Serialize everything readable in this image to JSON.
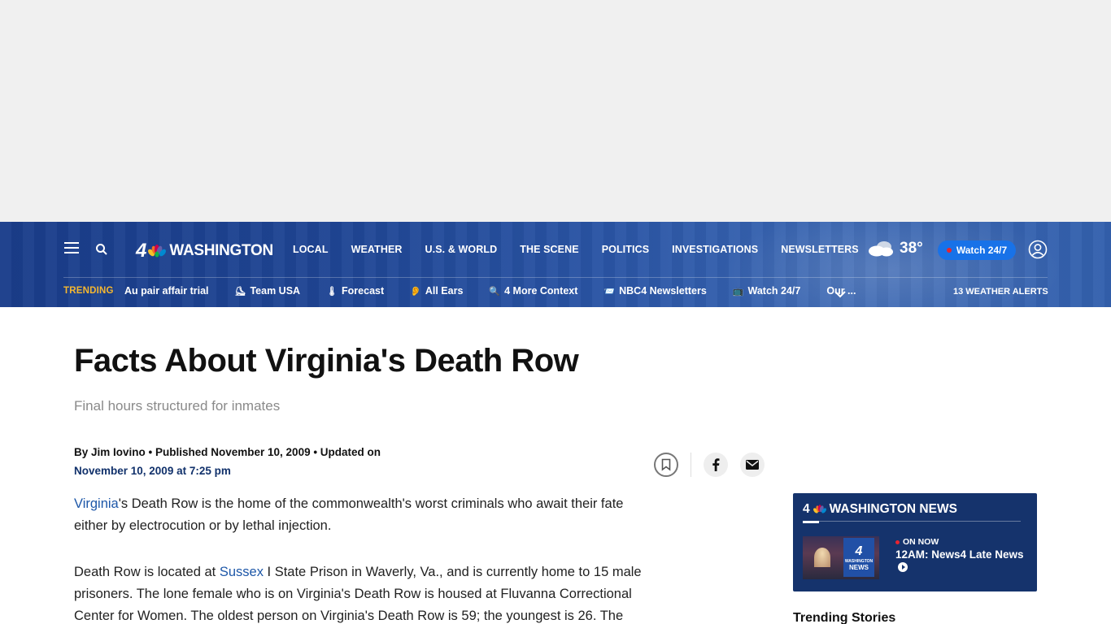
{
  "header": {
    "logo_number": "4",
    "logo_text": "WASHINGTON",
    "nav": [
      "LOCAL",
      "WEATHER",
      "U.S. & WORLD",
      "THE SCENE",
      "POLITICS",
      "INVESTIGATIONS",
      "NEWSLETTERS"
    ],
    "weather_temp": "38°",
    "watch_label": "Watch 24/7",
    "icons": {
      "menu": "hamburger-icon",
      "search": "search-icon",
      "weather": "cloudy-icon",
      "account": "user-icon"
    }
  },
  "trending": {
    "label": "TRENDING",
    "items": [
      {
        "label": "Au pair affair trial",
        "emoji": ""
      },
      {
        "label": "Team USA",
        "emoji": "⛸"
      },
      {
        "label": "Forecast",
        "emoji": "🌡"
      },
      {
        "label": "All Ears",
        "emoji": "👂"
      },
      {
        "label": "4 More Context",
        "emoji": "🔍"
      },
      {
        "label": "NBC4 Newsletters",
        "emoji": "📨"
      },
      {
        "label": "Watch 24/7",
        "emoji": "📺"
      },
      {
        "label": "Our ...",
        "emoji": ""
      }
    ],
    "alerts": "13 WEATHER ALERTS"
  },
  "article": {
    "title": "Facts About Virginia's Death Row",
    "subtitle": "Final hours structured for inmates",
    "byline_line1": "By Jim Iovino • Published November 10, 2009 • Updated on",
    "byline_line2": "November 10, 2009 at 7:25 pm",
    "p1_link": "Virginia",
    "p1_rest": "'s Death Row is the home of the commonwealth's worst criminals who await their fate either by electrocution or by lethal injection.",
    "p2_before": "Death Row is located at ",
    "p2_link": "Sussex",
    "p2_rest": " I State Prison in Waverly, Va., and is currently home to 15 male prisoners. The lone female who is on Virginia's Death Row is housed at Fluvanna Correctional Center for Women. The oldest person on Virginia's Death Row is 59; the youngest is 26. The"
  },
  "sidebar": {
    "card_title": "WASHINGTON NEWS",
    "on_now": "ON NOW",
    "show": "12AM: News4 Late News",
    "thumb_number": "4",
    "thumb_label_top": "WASHINGTON",
    "thumb_label_bottom": "NEWS",
    "trending_stories": "Trending Stories"
  },
  "colors": {
    "header_blue": "#1f4594",
    "trending_gold": "#f4b731",
    "watch_blue": "#1872e8",
    "live_red": "#e8242f",
    "card_navy": "#15336c",
    "link_blue": "#1d57a8"
  }
}
